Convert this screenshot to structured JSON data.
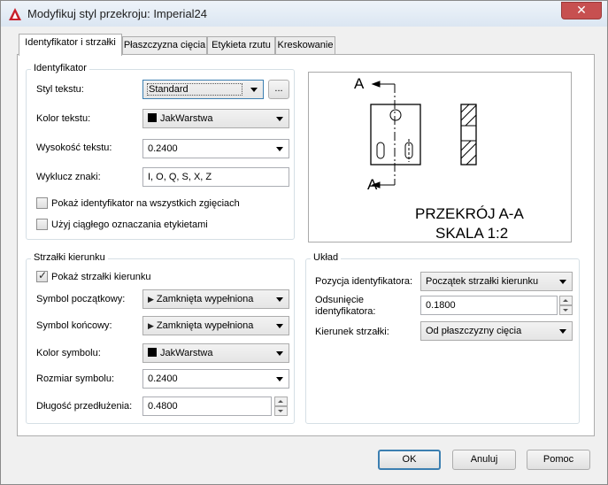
{
  "window": {
    "title": "Modyfikuj styl przekroju: Imperial24",
    "close_glyph": "✕"
  },
  "tabs": [
    {
      "label": "Identyfikator i strzałki"
    },
    {
      "label": "Płaszczyzna cięcia"
    },
    {
      "label": "Etykieta rzutu"
    },
    {
      "label": "Kreskowanie"
    }
  ],
  "identifier_group": {
    "title": "Identyfikator",
    "text_style_label": "Styl tekstu:",
    "text_style_value": "Standard",
    "browse_label": "...",
    "text_color_label": "Kolor tekstu:",
    "text_color_value": "JakWarstwa",
    "text_height_label": "Wysokość tekstu:",
    "text_height_value": "0.2400",
    "exclude_label": "Wyklucz znaki:",
    "exclude_value": "I, O, Q, S, X, Z",
    "show_all_bends_label": "Pokaż identyfikator na wszystkich zgięciach",
    "show_all_bends_checked": false,
    "continuous_label": "Użyj ciągłego oznaczania etykietami",
    "continuous_checked": false
  },
  "arrows_group": {
    "title": "Strzałki kierunku",
    "show_arrows_label": "Pokaż strzałki kierunku",
    "show_arrows_checked": true,
    "start_symbol_label": "Symbol początkowy:",
    "start_symbol_value": "Zamknięta wypełniona",
    "end_symbol_label": "Symbol końcowy:",
    "end_symbol_value": "Zamknięta wypełniona",
    "symbol_color_label": "Kolor symbolu:",
    "symbol_color_value": "JakWarstwa",
    "symbol_size_label": "Rozmiar symbolu:",
    "symbol_size_value": "0.2400",
    "extension_label": "Długość przedłużenia:",
    "extension_value": "0.4800"
  },
  "layout_group": {
    "title": "Układ",
    "position_label": "Pozycja identyfikatora:",
    "position_value": "Początek strzałki kierunku",
    "offset_label_1": "Odsunięcie",
    "offset_label_2": "identyfikatora:",
    "offset_value": "0.1800",
    "direction_label": "Kierunek strzałki:",
    "direction_value": "Od płaszczyzny cięcia"
  },
  "preview": {
    "cut_label_top": "A",
    "cut_label_bottom": "A",
    "section_title": "PRZEKRÓJ A-A",
    "scale_text": "SKALA 1:2"
  },
  "buttons": {
    "ok": "OK",
    "cancel": "Anuluj",
    "help": "Pomoc"
  },
  "colors": {
    "app_icon": "#c8202b",
    "close_button": "#c75050",
    "default_button_border": "#3c7fb1"
  },
  "icons": {
    "arrow_symbol": "closed-filled-arrow-icon",
    "color_swatch": "color-swatch-icon"
  }
}
